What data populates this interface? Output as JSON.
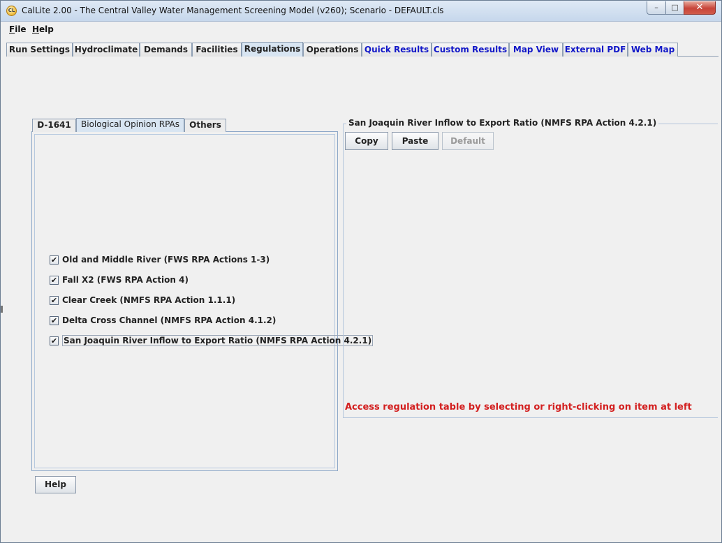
{
  "window": {
    "title": "CalLite 2.00 - The Central Valley Water Management Screening Model (v260); Scenario - DEFAULT.cls",
    "app_icon_text": "CL",
    "controls": {
      "minimize": "–",
      "maximize": "□",
      "close": "✕"
    }
  },
  "menu": {
    "items": [
      {
        "mnemonic": "F",
        "rest": "ile"
      },
      {
        "mnemonic": "H",
        "rest": "elp"
      }
    ]
  },
  "main_tabs": [
    {
      "label": "Run Settings"
    },
    {
      "label": "Hydroclimate"
    },
    {
      "label": "Demands"
    },
    {
      "label": "Facilities"
    },
    {
      "label": "Regulations",
      "active": true
    },
    {
      "label": "Operations"
    },
    {
      "label": "Quick Results"
    },
    {
      "label": "Custom Results"
    },
    {
      "label": "Map View"
    },
    {
      "label": "External PDF"
    },
    {
      "label": "Web Map"
    }
  ],
  "sub_tabs": [
    {
      "label": "D-1641"
    },
    {
      "label": "Biological Opinion RPAs",
      "active": true
    },
    {
      "label": "Others"
    }
  ],
  "regulations": [
    {
      "label": "Old and Middle River (FWS RPA Actions 1-3)",
      "checked": true
    },
    {
      "label": "Fall X2 (FWS RPA Action 4)",
      "checked": true
    },
    {
      "label": "Clear Creek (NMFS RPA Action 1.1.1)",
      "checked": true
    },
    {
      "label": "Delta Cross Channel (NMFS RPA Action 4.1.2)",
      "checked": true
    },
    {
      "label": "San Joaquin River Inflow to Export Ratio (NMFS RPA Action 4.2.1)",
      "checked": true,
      "focused": true
    }
  ],
  "check_mark": "✔",
  "help_button": "Help",
  "detail_panel": {
    "title": "San Joaquin River Inflow to Export Ratio (NMFS RPA Action 4.2.1)",
    "buttons": {
      "copy": "Copy",
      "paste": "Paste",
      "default": "Default"
    },
    "hint": "Access regulation table by selecting or right-clicking on item at left"
  },
  "colors": {
    "link_tab": "#1218c8",
    "hint": "#d32020",
    "active_tab": "#d8e5f2"
  }
}
